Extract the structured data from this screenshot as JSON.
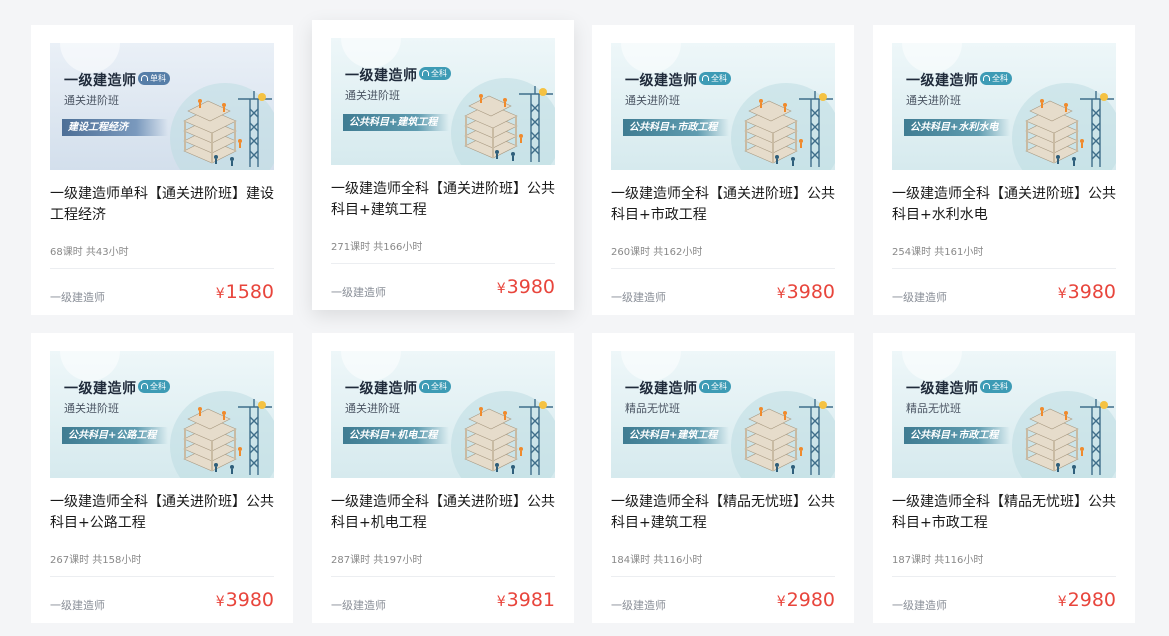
{
  "courses": [
    {
      "brand": "一级建造师",
      "tag": "单科",
      "level": "通关进阶班",
      "banner": "建设工程经济",
      "title": "一级建造师单科【通关进阶班】建设工程经济",
      "hours": "68课时 共43小时",
      "category": "一级建造师",
      "currency": "¥",
      "price": "1580",
      "theme": "blue"
    },
    {
      "brand": "一级建造师",
      "tag": "全科",
      "level": "通关进阶班",
      "banner": "公共科目+建筑工程",
      "title": "一级建造师全科【通关进阶班】公共科目+建筑工程",
      "hours": "271课时 共166小时",
      "category": "一级建造师",
      "currency": "¥",
      "price": "3980",
      "theme": "teal"
    },
    {
      "brand": "一级建造师",
      "tag": "全科",
      "level": "通关进阶班",
      "banner": "公共科目+市政工程",
      "title": "一级建造师全科【通关进阶班】公共科目+市政工程",
      "hours": "260课时 共162小时",
      "category": "一级建造师",
      "currency": "¥",
      "price": "3980",
      "theme": "teal"
    },
    {
      "brand": "一级建造师",
      "tag": "全科",
      "level": "通关进阶班",
      "banner": "公共科目+水利水电",
      "title": "一级建造师全科【通关进阶班】公共科目+水利水电",
      "hours": "254课时 共161小时",
      "category": "一级建造师",
      "currency": "¥",
      "price": "3980",
      "theme": "teal"
    },
    {
      "brand": "一级建造师",
      "tag": "全科",
      "level": "通关进阶班",
      "banner": "公共科目+公路工程",
      "title": "一级建造师全科【通关进阶班】公共科目+公路工程",
      "hours": "267课时 共158小时",
      "category": "一级建造师",
      "currency": "¥",
      "price": "3980",
      "theme": "teal"
    },
    {
      "brand": "一级建造师",
      "tag": "全科",
      "level": "通关进阶班",
      "banner": "公共科目+机电工程",
      "title": "一级建造师全科【通关进阶班】公共科目+机电工程",
      "hours": "287课时 共197小时",
      "category": "一级建造师",
      "currency": "¥",
      "price": "3981",
      "theme": "teal"
    },
    {
      "brand": "一级建造师",
      "tag": "全科",
      "level": "精品无忧班",
      "banner": "公共科目+建筑工程",
      "title": "一级建造师全科【精品无忧班】公共科目+建筑工程",
      "hours": "184课时 共116小时",
      "category": "一级建造师",
      "currency": "¥",
      "price": "2980",
      "theme": "teal"
    },
    {
      "brand": "一级建造师",
      "tag": "全科",
      "level": "精品无忧班",
      "banner": "公共科目+市政工程",
      "title": "一级建造师全科【精品无忧班】公共科目+市政工程",
      "hours": "187课时 共116小时",
      "category": "一级建造师",
      "currency": "¥",
      "price": "2980",
      "theme": "teal"
    }
  ],
  "colors": {
    "price": "#e8453c",
    "tag_teal": "#3d9bb5",
    "tag_blue": "#567ea8",
    "page_bg": "#f4f5f7"
  }
}
